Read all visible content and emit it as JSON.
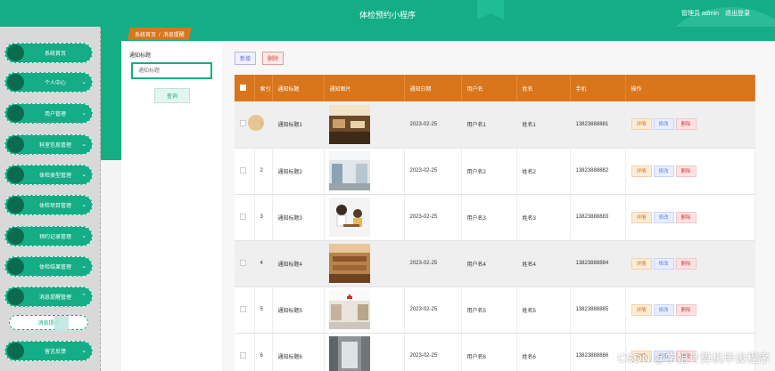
{
  "header": {
    "title": "体检预约小程序",
    "user_label": "管理员 admin",
    "logout": "退出登录"
  },
  "sidebar": {
    "items": [
      {
        "label": "系统首页",
        "chevron": false
      },
      {
        "label": "个人中心",
        "chevron": true
      },
      {
        "label": "用户管理",
        "chevron": true
      },
      {
        "label": "科室信息管理",
        "chevron": true
      },
      {
        "label": "体检类型管理",
        "chevron": true
      },
      {
        "label": "体检项目管理",
        "chevron": true
      },
      {
        "label": "预约记录管理",
        "chevron": true
      },
      {
        "label": "体检结果管理",
        "chevron": true
      },
      {
        "label": "消息提醒管理",
        "chevron": true,
        "expanded": true
      },
      {
        "label": "留言反馈",
        "chevron": true
      }
    ],
    "sub_item": "消息提醒"
  },
  "breadcrumb": {
    "home": "系统首页",
    "separator": "/",
    "current": "消息提醒"
  },
  "search": {
    "label": "通知标题",
    "placeholder": "通知标题",
    "button": "查询"
  },
  "toolbar": {
    "add": "新增",
    "delete": "删除"
  },
  "table": {
    "headers": [
      "索引",
      "通知标题",
      "通知图片",
      "通知日期",
      "用户名",
      "姓名",
      "手机",
      "操作"
    ],
    "actions": {
      "detail": "详情",
      "edit": "修改",
      "delete": "删除"
    },
    "rows": [
      {
        "index": "1",
        "title": "通知标题1",
        "image": "restaurant-photo",
        "date": "2023-02-25",
        "username": "用户名1",
        "name": "姓名1",
        "phone": "13823888881"
      },
      {
        "index": "2",
        "title": "通知标题2",
        "image": "hallway-photo",
        "date": "2023-02-25",
        "username": "用户名2",
        "name": "姓名2",
        "phone": "13823888882"
      },
      {
        "index": "3",
        "title": "通知标题3",
        "image": "cartoon-consultation",
        "date": "2023-02-25",
        "username": "用户名3",
        "name": "姓名3",
        "phone": "13823888883"
      },
      {
        "index": "4",
        "title": "通知标题4",
        "image": "wooden-interior-photo",
        "date": "2023-02-25",
        "username": "用户名4",
        "name": "姓名4",
        "phone": "13823888884"
      },
      {
        "index": "5",
        "title": "通知标题5",
        "image": "hospital-lobby-photo",
        "date": "2023-02-25",
        "username": "用户名5",
        "name": "姓名5",
        "phone": "13823888885"
      },
      {
        "index": "6",
        "title": "通知标题6",
        "image": "corridor-photo",
        "date": "2023-02-25",
        "username": "用户名6",
        "name": "姓名6",
        "phone": "13823888886"
      }
    ]
  },
  "watermark": "CSDN @学姐计算机毕设程序"
}
